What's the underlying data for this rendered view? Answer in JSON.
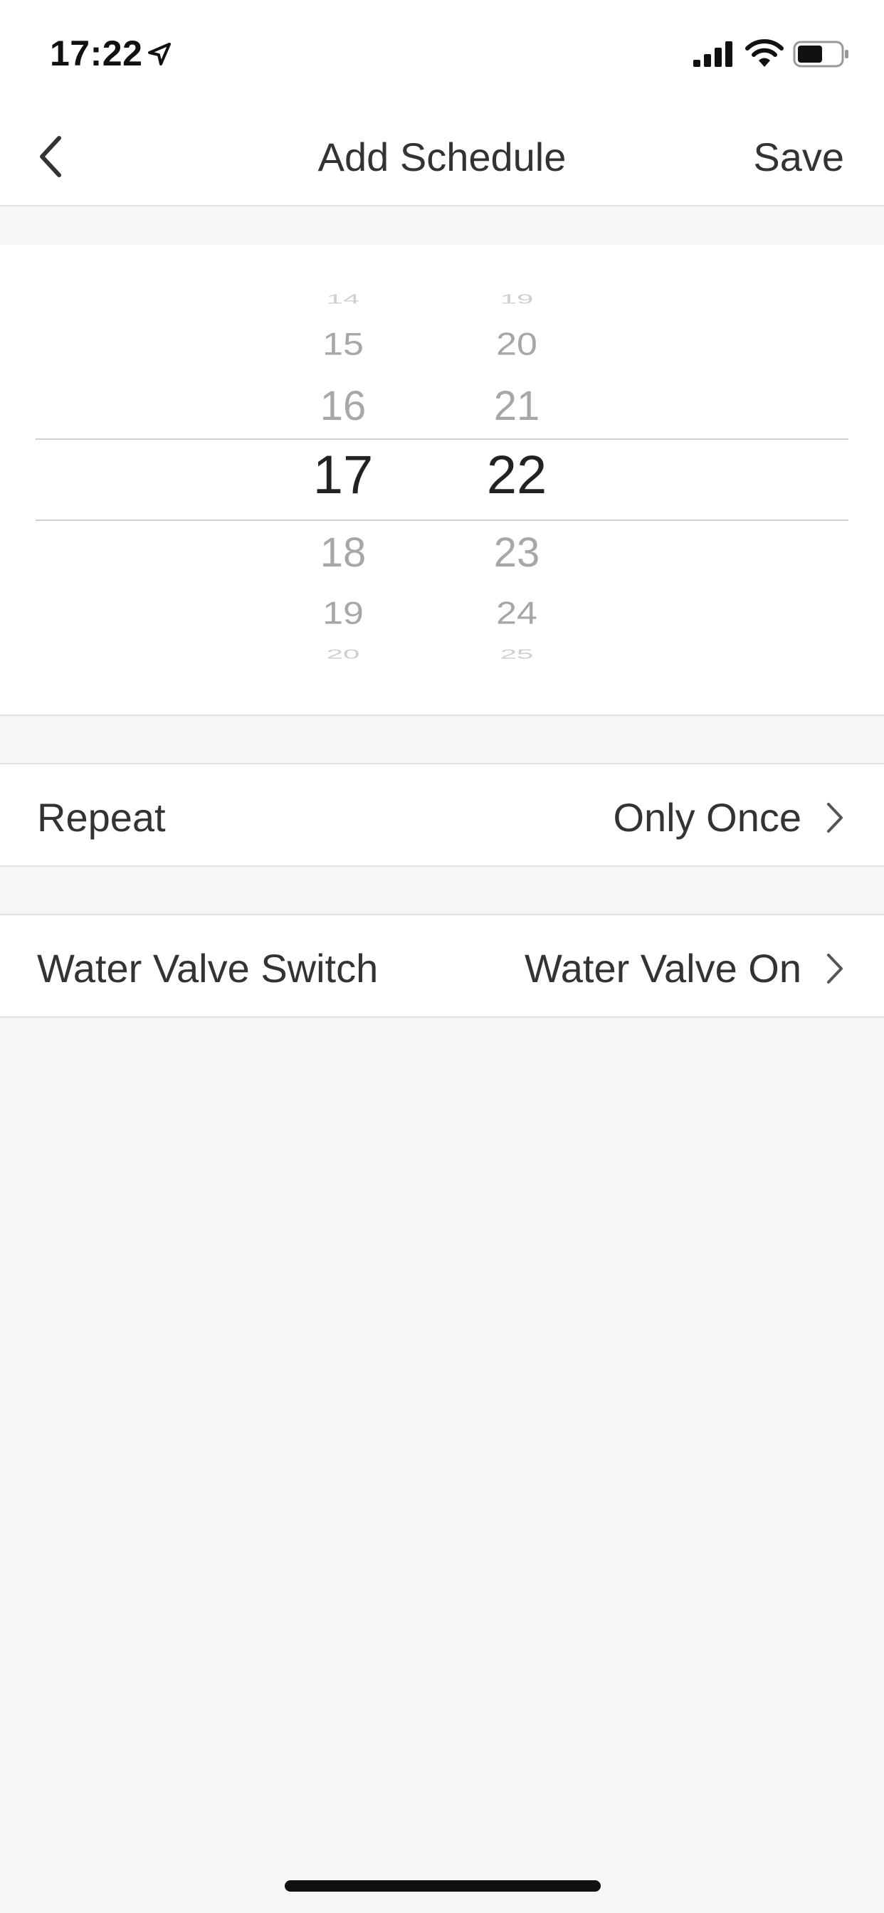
{
  "status_bar": {
    "time": "17:22",
    "icons": [
      "location-arrow-icon",
      "cellular-signal-icon",
      "wifi-icon",
      "battery-icon"
    ]
  },
  "nav": {
    "title": "Add Schedule",
    "save_label": "Save",
    "back_icon": "chevron-left-icon"
  },
  "picker": {
    "hours": [
      "14",
      "15",
      "16",
      "17",
      "18",
      "19",
      "20"
    ],
    "minutes": [
      "19",
      "20",
      "21",
      "22",
      "23",
      "24",
      "25"
    ],
    "selected_hour": "17",
    "selected_minute": "22"
  },
  "rows": [
    {
      "label": "Repeat",
      "value": "Only Once",
      "icon": "chevron-right-icon"
    },
    {
      "label": "Water Valve Switch",
      "value": "Water Valve On",
      "icon": "chevron-right-icon"
    }
  ],
  "colors": {
    "background": "#f6f6f6",
    "card": "#ffffff",
    "text": "#333333",
    "picker_faded": "#a7a7a7",
    "divider": "#e1e1e1"
  }
}
